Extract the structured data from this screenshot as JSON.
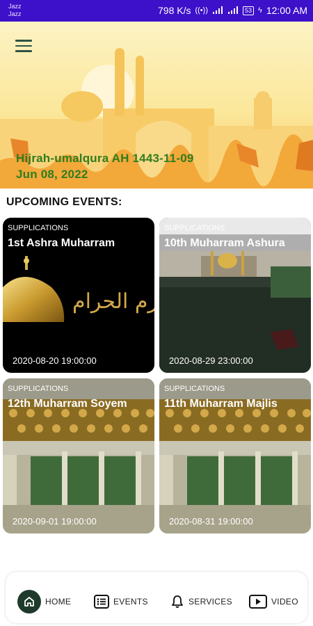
{
  "status_bar": {
    "carrier_1": "Jazz",
    "carrier_2": "Jazz",
    "speed": "798 K/s",
    "battery": "53",
    "time": "12:00 AM"
  },
  "header": {
    "hijri_date": "Hijrah-umalqura AH 1443-11-09",
    "gregorian_date": "Jun 08, 2022"
  },
  "section_title": "UPCOMING EVENTS:",
  "events": [
    {
      "category": "SUPPLICATIONS",
      "title": "1st Ashra Muharram",
      "datetime": "2020-08-20 19:00:00",
      "image_text": "محرم الحرام"
    },
    {
      "category": "SUPPLICATIONS",
      "title": "10th Muharram Ashura",
      "datetime": "2020-08-29 23:00:00"
    },
    {
      "category": "SUPPLICATIONS",
      "title": "12th Muharram Soyem",
      "datetime": "2020-09-01 19:00:00"
    },
    {
      "category": "SUPPLICATIONS",
      "title": "11th Muharram Majlis",
      "datetime": "2020-08-31 19:00:00"
    }
  ],
  "bottom_nav": {
    "home": "HOME",
    "events": "EVENTS",
    "services": "SERVICES",
    "video": "VIDEO"
  }
}
